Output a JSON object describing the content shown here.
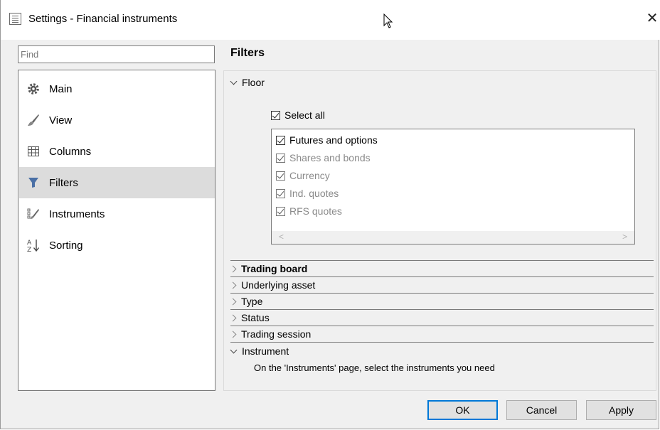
{
  "window": {
    "title": "Settings - Financial instruments",
    "close_glyph": "✕"
  },
  "search": {
    "placeholder": "Find",
    "value": ""
  },
  "sidebar": {
    "items": [
      {
        "label": "Main",
        "icon": "gear-icon",
        "selected": false
      },
      {
        "label": "View",
        "icon": "brush-icon",
        "selected": false
      },
      {
        "label": "Columns",
        "icon": "table-icon",
        "selected": false
      },
      {
        "label": "Filters",
        "icon": "funnel-icon",
        "selected": true
      },
      {
        "label": "Instruments",
        "icon": "instruments-icon",
        "selected": false
      },
      {
        "label": "Sorting",
        "icon": "sort-az-icon",
        "selected": false
      }
    ]
  },
  "main": {
    "heading": "Filters",
    "floor": {
      "label": "Floor",
      "select_all_label": "Select all",
      "items": [
        {
          "label": "Futures and options",
          "checked": true,
          "enabled": true
        },
        {
          "label": "Shares and bonds",
          "checked": true,
          "enabled": false
        },
        {
          "label": "Currency",
          "checked": true,
          "enabled": false
        },
        {
          "label": "Ind. quotes",
          "checked": true,
          "enabled": false
        },
        {
          "label": "RFS quotes",
          "checked": true,
          "enabled": false
        }
      ]
    },
    "sections": [
      {
        "label": "Trading board",
        "bold": true
      },
      {
        "label": "Underlying asset",
        "bold": false
      },
      {
        "label": "Type",
        "bold": false
      },
      {
        "label": "Status",
        "bold": false
      },
      {
        "label": "Trading session",
        "bold": false
      }
    ],
    "instrument": {
      "label": "Instrument",
      "hint": "On the 'Instruments' page, select the instruments you need"
    }
  },
  "buttons": {
    "ok": "OK",
    "cancel": "Cancel",
    "apply": "Apply"
  },
  "colors": {
    "accent": "#0078d7",
    "selection": "#dcdcdc",
    "disabled_text": "#8a8a8a"
  }
}
